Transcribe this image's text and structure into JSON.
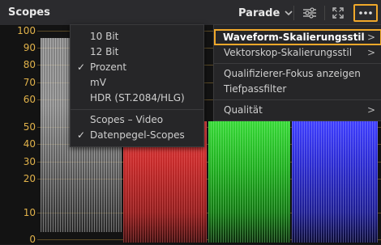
{
  "header": {
    "title": "Scopes",
    "mode": "Parade",
    "icons": [
      "chevron-down-icon",
      "sliders-icon",
      "expand-icon",
      "more-icon"
    ]
  },
  "scope": {
    "y_ticks": [
      "100",
      "90",
      "80",
      "70",
      "60",
      "50",
      "40",
      "30",
      "20",
      "10",
      "0"
    ],
    "colors": {
      "tick": "#e1b24a",
      "accent": "#f0a82a"
    }
  },
  "menu_left": {
    "items": [
      {
        "label": "10 Bit",
        "checked": false
      },
      {
        "label": "12 Bit",
        "checked": false
      },
      {
        "label": "Prozent",
        "checked": true
      },
      {
        "label": "mV",
        "checked": false
      },
      {
        "label": "HDR (ST.2084/HLG)",
        "checked": false
      }
    ],
    "items2": [
      {
        "label": "Scopes – Video",
        "checked": false
      },
      {
        "label": "Datenpegel-Scopes",
        "checked": true
      }
    ],
    "check_glyph": "✓"
  },
  "menu_right": {
    "items": [
      {
        "label": "Waveform-Skalierungsstil",
        "arrow": ">"
      },
      {
        "label": "Vektorskop-Skalierungsstil",
        "arrow": ">"
      },
      {
        "label": "Qualifizierer-Fokus anzeigen",
        "arrow": ""
      },
      {
        "label": "Tiefpassfilter",
        "arrow": ""
      },
      {
        "label": "Qualität",
        "arrow": ">"
      }
    ]
  }
}
